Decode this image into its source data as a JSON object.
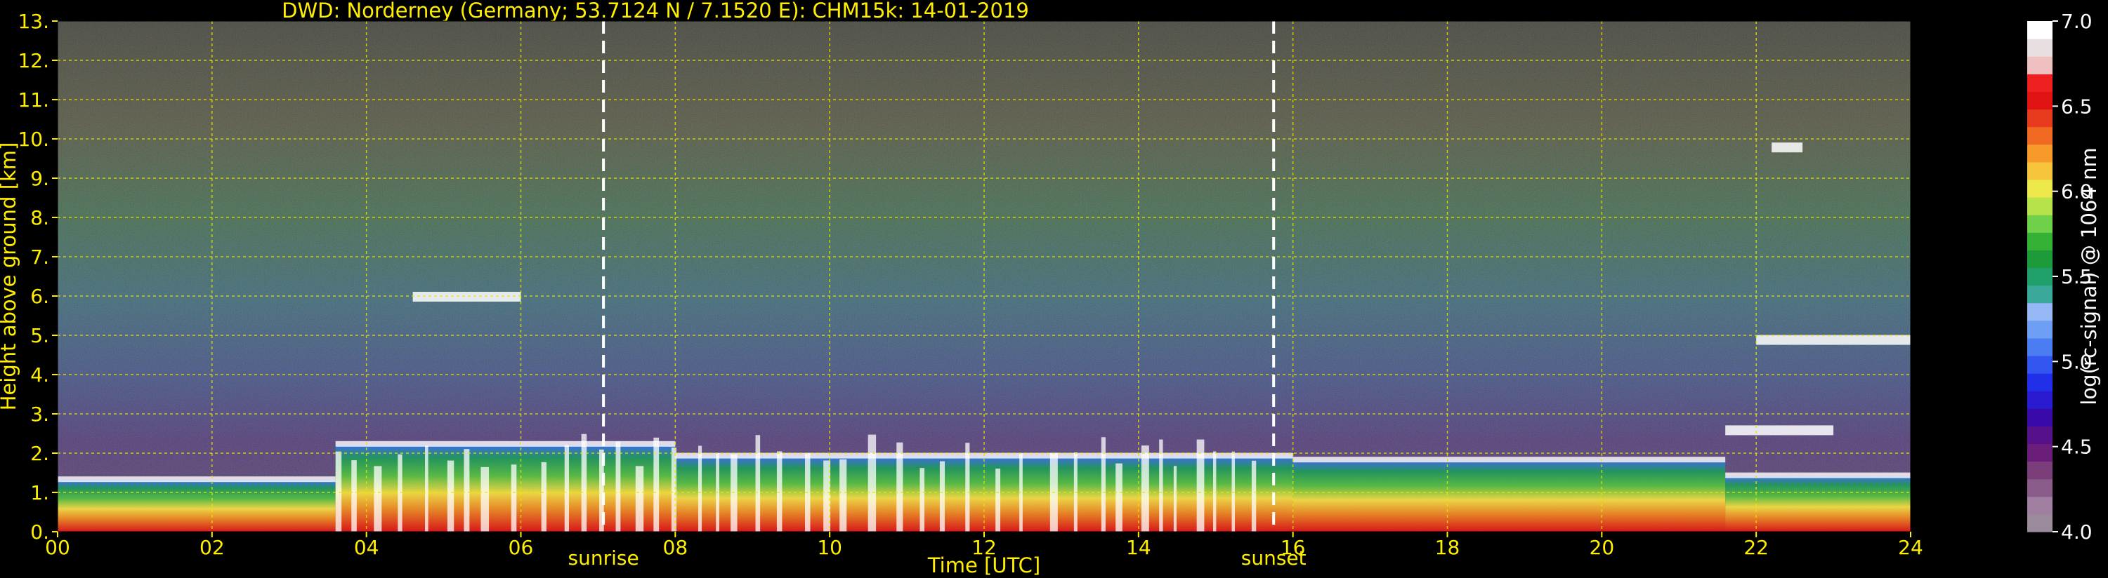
{
  "chart_data": {
    "type": "heatmap",
    "title": "DWD: Norderney (Germany; 53.7124 N / 7.1520 E):    CHM15k: 14-01-2019",
    "xlabel": "Time [UTC]",
    "ylabel": "Height above ground [km]",
    "xlim": [
      0,
      24
    ],
    "ylim": [
      0,
      13
    ],
    "x_ticks": [
      "00",
      "02",
      "04",
      "06",
      "08",
      "10",
      "12",
      "14",
      "16",
      "18",
      "20",
      "22",
      "24"
    ],
    "y_ticks": [
      "0.",
      "1.",
      "2.",
      "3.",
      "4.",
      "5.",
      "6.",
      "7.",
      "8.",
      "9.",
      "10.",
      "11.",
      "12.",
      "13."
    ],
    "grid": true,
    "colorbar": {
      "label": "log(rc-signal) @ 1064 nm",
      "range": [
        4.0,
        7.0
      ],
      "ticks": [
        "4.0",
        "4.5",
        "5.0",
        "5.5",
        "6.0",
        "6.5",
        "7.0"
      ],
      "colors": [
        "#9a8a9a",
        "#a07fa0",
        "#8a5c8a",
        "#7a3f7a",
        "#6a1e7a",
        "#55108a",
        "#3a0aa8",
        "#2a1ad0",
        "#1f30e8",
        "#3356f0",
        "#4a7cf2",
        "#6f9ef5",
        "#96b8f7",
        "#3aa89a",
        "#1fa06a",
        "#1d9a3a",
        "#34b034",
        "#6fd04a",
        "#b8e24a",
        "#ece84a",
        "#f6c43a",
        "#f79a2a",
        "#f06a22",
        "#e83a1c",
        "#e01212",
        "#ee2020",
        "#f0c0c0",
        "#e8e0e0",
        "#ffffff"
      ]
    },
    "annotations": [
      {
        "x": 7.07,
        "label": "sunrise"
      },
      {
        "x": 15.75,
        "label": "sunset"
      }
    ],
    "cloud_base_segments_km": [
      {
        "from": 0.0,
        "to": 3.6,
        "top": 1.3
      },
      {
        "from": 3.6,
        "to": 8.0,
        "top": 2.2
      },
      {
        "from": 8.0,
        "to": 16.0,
        "top": 1.9
      },
      {
        "from": 16.0,
        "to": 21.6,
        "top": 1.8
      },
      {
        "from": 21.6,
        "to": 24.0,
        "top": 1.4
      }
    ],
    "elevated_layers_km": [
      {
        "from": 4.6,
        "to": 6.0,
        "height": 6.0
      },
      {
        "from": 21.6,
        "to": 23.0,
        "height": 2.6
      },
      {
        "from": 22.0,
        "to": 24.0,
        "height": 4.9
      },
      {
        "from": 22.2,
        "to": 22.6,
        "height": 9.8
      }
    ]
  }
}
